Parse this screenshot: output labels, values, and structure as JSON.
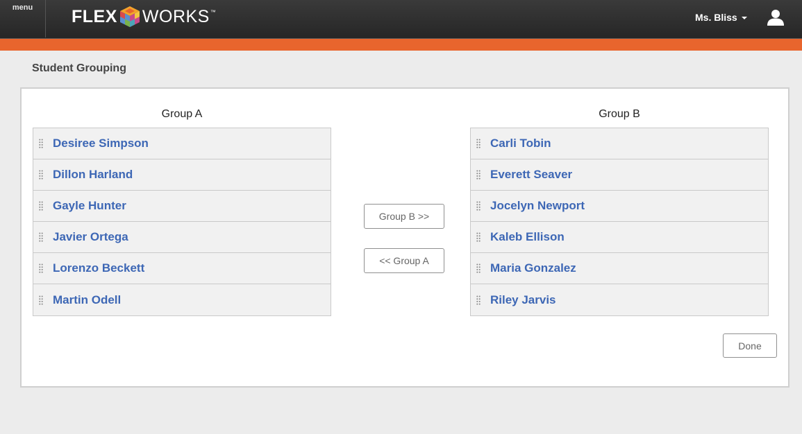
{
  "header": {
    "menu_label": "menu",
    "logo_left": "FLEX",
    "logo_right": "WORKS",
    "logo_tm": "™",
    "user_name": "Ms. Bliss"
  },
  "page": {
    "title": "Student Grouping"
  },
  "groups": {
    "a": {
      "title": "Group A",
      "students": [
        "Desiree Simpson",
        "Dillon Harland",
        "Gayle Hunter",
        "Javier Ortega",
        "Lorenzo Beckett",
        "Martin Odell"
      ]
    },
    "b": {
      "title": "Group B",
      "students": [
        "Carli Tobin",
        "Everett Seaver",
        "Jocelyn Newport",
        "Kaleb Ellison",
        "Maria Gonzalez",
        "Riley Jarvis"
      ]
    }
  },
  "buttons": {
    "move_to_b": "Group B >>",
    "move_to_a": "<< Group A",
    "done": "Done"
  },
  "colors": {
    "accent": "#e8652d",
    "link": "#3d67b5"
  }
}
